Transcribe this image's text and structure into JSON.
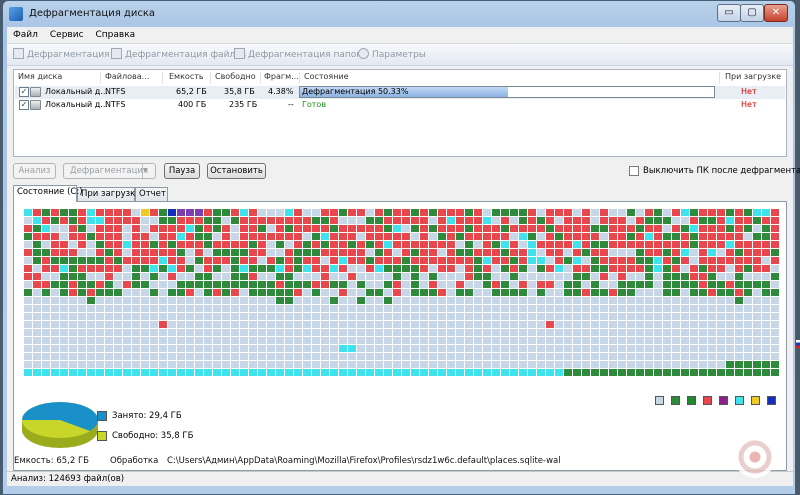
{
  "window": {
    "title": "Дефрагментация диска",
    "min": "▭",
    "max": "▢",
    "close": "✕"
  },
  "menu": [
    "Файл",
    "Сервис",
    "Справка"
  ],
  "toolbar": {
    "defrag": "Дефрагментация",
    "defrag_files": "Дефрагментация файлов",
    "defrag_folders": "Дефрагментация папок",
    "settings": "Параметры"
  },
  "columns": [
    "Имя диска",
    "Файлова...",
    "Емкость",
    "Свободно",
    "Фрагм...",
    "Состояние",
    "При загрузке"
  ],
  "drives": [
    {
      "name": "Локальный д...",
      "fs": "NTFS",
      "capacity": "65,2 ГБ",
      "free": "35,8 ГБ",
      "frag": "4.38%",
      "state": "Дефрагментация 50.33%",
      "progress": 0.5033,
      "boot": "Нет"
    },
    {
      "name": "Локальный д...",
      "fs": "NTFS",
      "capacity": "400 ГБ",
      "free": "235 ГБ",
      "frag": "--",
      "state": "Готов",
      "boot": "Нет"
    }
  ],
  "buttons": {
    "analyze": "Анализ",
    "defrag": "Дефрагментация",
    "pause": "Пауза",
    "stop": "Остановить",
    "dd": "▼"
  },
  "shutdown_label": "Выключить ПК после дефрагментации",
  "tabs": [
    "Состояние (C:)",
    "При загрузке",
    "Отчет"
  ],
  "colors": {
    "fragmented": "#e8474e",
    "defragmented": "#2e8b3c",
    "free": "#c7d7e8",
    "busy": "#3fe3ee",
    "mft": "#7b3fb0",
    "locked": "#f0ca24",
    "dark_blue": "#142dbd"
  },
  "legend_colors": [
    "#c7d7e8",
    "#2e8b3c",
    "#1f8a2b",
    "#e8474e",
    "#8b1f8b",
    "#3fe3ee",
    "#f0ca24",
    "#142dbd"
  ],
  "pie": {
    "used_label": "Занято: 29,4 ГБ",
    "free_label": "Свободно: 35,8 ГБ",
    "used_color": "#1a90c9",
    "free_color": "#c8d62a"
  },
  "info": {
    "capacity": "Емкость: 65,2 ГБ",
    "processing_label": "Обработка",
    "path": "C:\\Users\\Админ\\AppData\\Roaming\\Mozilla\\Firefox\\Profiles\\rsdz1w6c.default\\places.sqlite-wal"
  },
  "status": "Анализ: 124693 файл(ов)"
}
